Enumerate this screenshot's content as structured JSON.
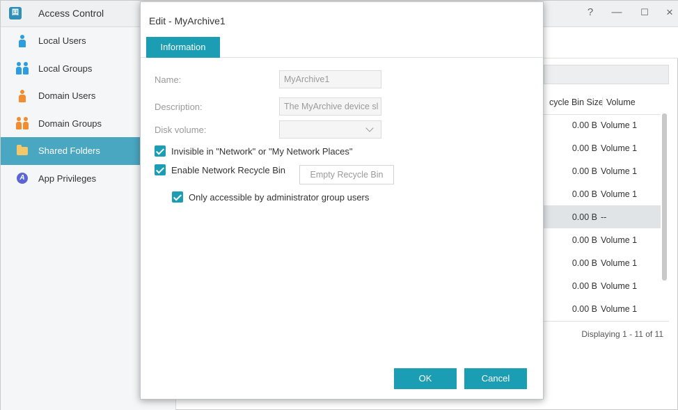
{
  "app": {
    "title": "Access Control",
    "icon": "access-control-icon",
    "window_controls": {
      "help": "?",
      "minimize": "—",
      "maximize": "☐",
      "close": "×"
    }
  },
  "sidebar": {
    "items": [
      {
        "label": "Local Users",
        "icon": "user-icon",
        "color": "#2d9de0",
        "active": false
      },
      {
        "label": "Local Groups",
        "icon": "group-icon",
        "color": "#2d9de0",
        "active": false
      },
      {
        "label": "Domain Users",
        "icon": "user-icon",
        "color": "#f28c2f",
        "active": false
      },
      {
        "label": "Domain Groups",
        "icon": "group-icon",
        "color": "#f28c2f",
        "active": false
      },
      {
        "label": "Shared Folders",
        "icon": "folder-icon",
        "color": "#f3c86a",
        "active": true
      },
      {
        "label": "App Privileges",
        "icon": "app-privileges-icon",
        "color": "#5b66d6",
        "active": false
      }
    ]
  },
  "grid": {
    "columns": {
      "recycle_bin_size": "cycle Bin Size",
      "volume": "Volume"
    },
    "rows": [
      {
        "size": "0.00 B",
        "volume": "Volume 1"
      },
      {
        "size": "0.00 B",
        "volume": "Volume 1"
      },
      {
        "size": "0.00 B",
        "volume": "Volume 1"
      },
      {
        "size": "0.00 B",
        "volume": "Volume 1"
      },
      {
        "size": "0.00 B",
        "volume": "--"
      },
      {
        "size": "0.00 B",
        "volume": "Volume 1"
      },
      {
        "size": "0.00 B",
        "volume": "Volume 1"
      },
      {
        "size": "0.00 B",
        "volume": "Volume 1"
      },
      {
        "size": "0.00 B",
        "volume": "Volume 1"
      }
    ],
    "footer": "Displaying 1 - 11 of 11"
  },
  "dialog": {
    "title": "Edit - MyArchive1",
    "tab": "Information",
    "fields": {
      "name_label": "Name:",
      "name_value": "MyArchive1",
      "description_label": "Description:",
      "description_value": "The MyArchive device sl",
      "disk_volume_label": "Disk volume:",
      "disk_volume_value": ""
    },
    "checks": {
      "invisible_label": "Invisible in \"Network\" or \"My Network Places\"",
      "invisible_checked": true,
      "recycle_label": "Enable Network Recycle Bin",
      "recycle_checked": true,
      "admin_only_label": "Only accessible by administrator group users",
      "admin_only_checked": true
    },
    "empty_recycle_bin": "Empty Recycle Bin",
    "ok": "OK",
    "cancel": "Cancel"
  },
  "colors": {
    "accent": "#1b9eb3",
    "sidebar_active": "#4aa7c1"
  }
}
